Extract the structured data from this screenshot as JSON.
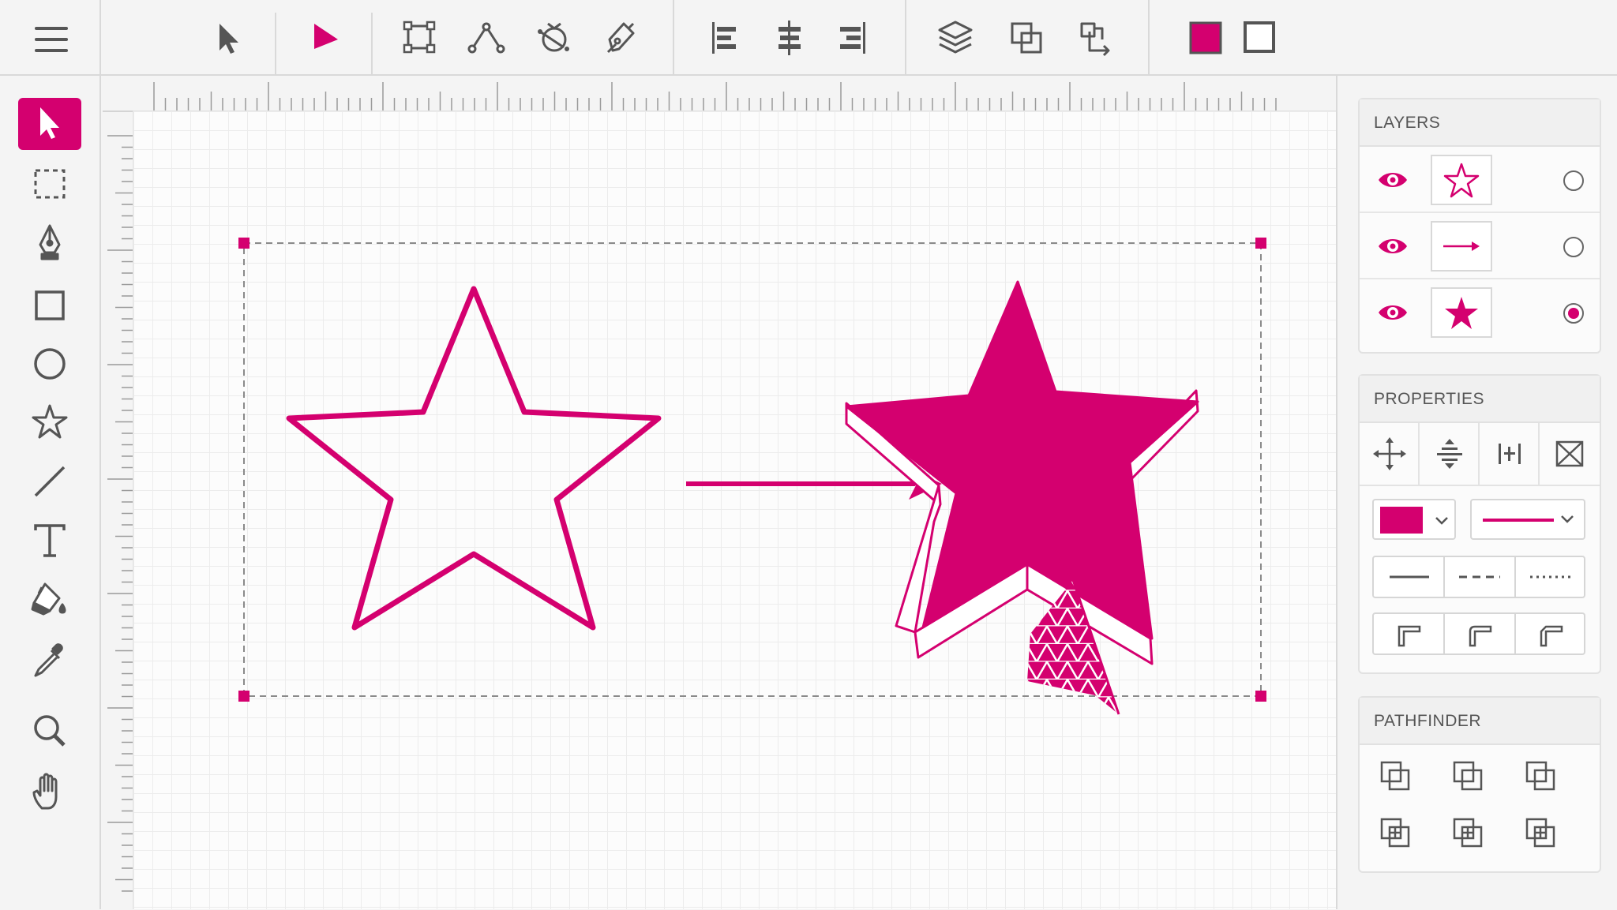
{
  "app": {
    "accent_color": "#d4006f",
    "icon_color": "#555555"
  },
  "topbar": {
    "menu_icon": "hamburger-menu-icon",
    "tools": [
      "selection-tool-icon",
      "direct-selection-tool-icon",
      "free-transform-icon",
      "anchor-point-icon",
      "rotate-icon",
      "pen-edit-icon",
      "align-left-icon",
      "align-center-icon",
      "align-right-icon",
      "layers-icon",
      "group-icon",
      "transform-copy-icon"
    ],
    "fill_color": "#d4006f",
    "stroke_color": "none"
  },
  "left_tools": [
    {
      "icon": "selection-arrow-icon",
      "active": true
    },
    {
      "icon": "marquee-select-icon",
      "active": false
    },
    {
      "icon": "pen-tool-icon",
      "active": false
    },
    {
      "icon": "rectangle-tool-icon",
      "active": false
    },
    {
      "icon": "ellipse-tool-icon",
      "active": false
    },
    {
      "icon": "star-tool-icon",
      "active": false
    },
    {
      "icon": "line-tool-icon",
      "active": false
    },
    {
      "icon": "type-tool-icon",
      "active": false
    },
    {
      "icon": "paint-bucket-icon",
      "active": false
    },
    {
      "icon": "eyedropper-icon",
      "active": false
    },
    {
      "icon": "zoom-icon",
      "active": false
    },
    {
      "icon": "hand-tool-icon",
      "active": false
    }
  ],
  "canvas": {
    "artwork": [
      "outline-star",
      "transform-arrow",
      "filled-3d-star"
    ]
  },
  "panels": {
    "layers": {
      "title": "LAYERS",
      "rows": [
        {
          "thumb": "outline-star-thumb",
          "visible": true,
          "selected": false
        },
        {
          "thumb": "arrow-thumb",
          "visible": true,
          "selected": false
        },
        {
          "thumb": "filled-star-thumb",
          "visible": true,
          "selected": true
        }
      ]
    },
    "properties": {
      "title": "PROPERTIES",
      "transform_icons": [
        "move-icon",
        "distribute-vertical-icon",
        "distribute-horizontal-icon",
        "fit-frame-icon"
      ],
      "fill_swatch": "#d4006f",
      "stroke_styles": [
        "solid-line",
        "dashed-line",
        "dotted-line"
      ],
      "corner_styles": [
        "corner-miter-icon",
        "corner-round-icon",
        "corner-bevel-icon"
      ]
    },
    "pathfinder": {
      "title": "PATHFINDER",
      "ops": [
        "unite-icon",
        "minus-front-icon",
        "intersect-icon",
        "exclude-icon",
        "divide-icon",
        "trim-icon"
      ]
    }
  }
}
